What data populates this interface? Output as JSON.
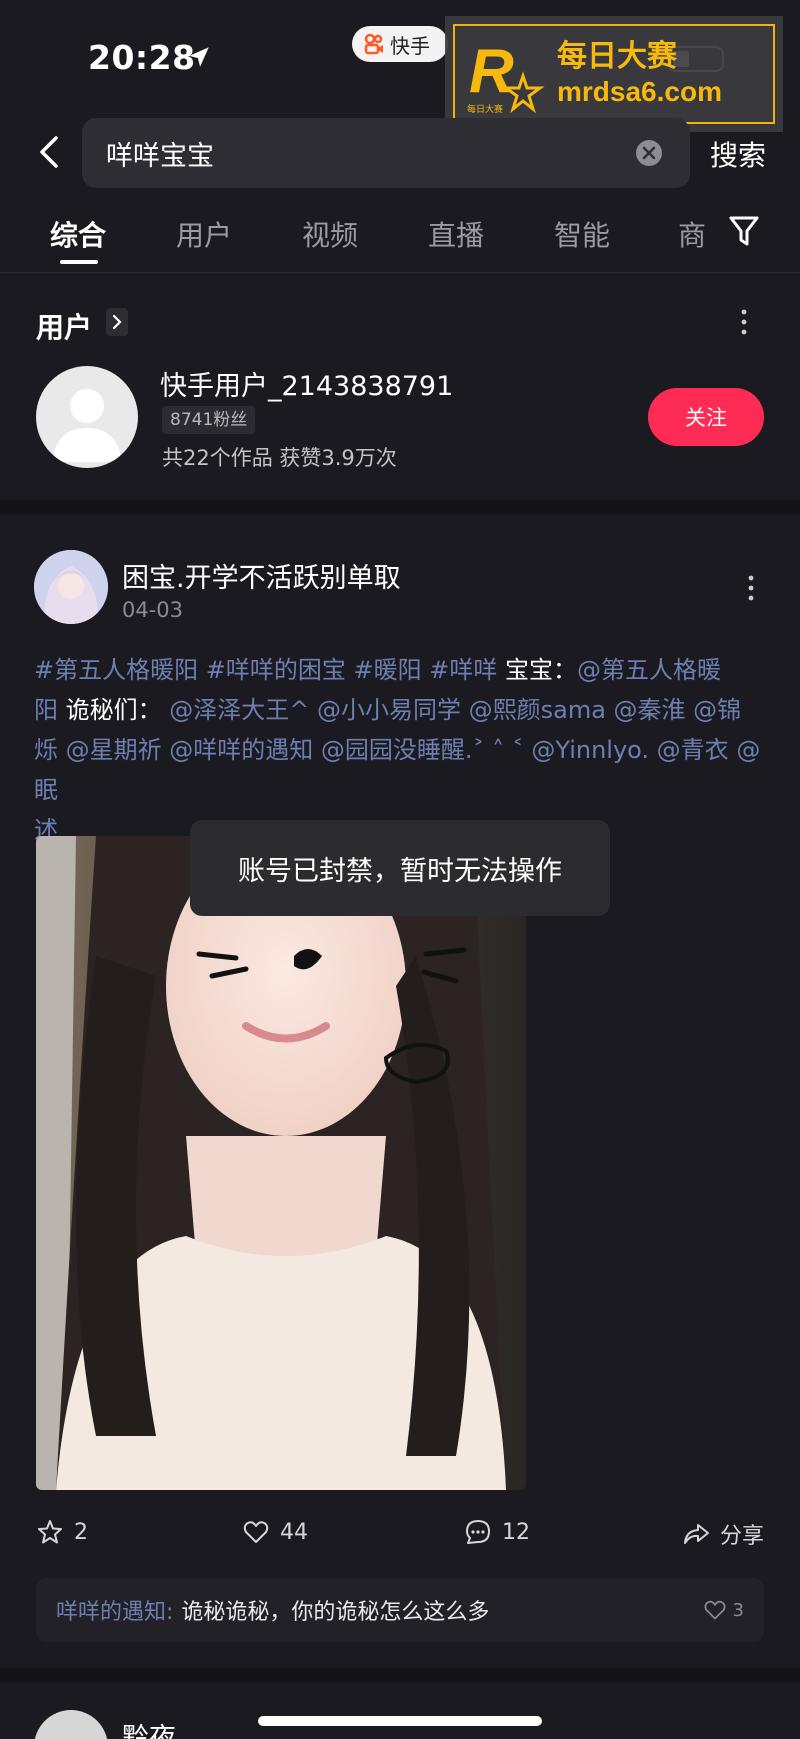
{
  "status_bar": {
    "time": "20:28",
    "app_pill_label": "快手",
    "watermark_title": "每日大赛",
    "watermark_url": "mrdsa6.com",
    "watermark_logo_text": "每日大赛"
  },
  "search": {
    "query": "咩咩宝宝",
    "button_label": "搜索"
  },
  "tabs": [
    {
      "label": "综合",
      "active": true
    },
    {
      "label": "用户",
      "active": false
    },
    {
      "label": "视频",
      "active": false
    },
    {
      "label": "直播",
      "active": false
    },
    {
      "label": "智能",
      "active": false
    },
    {
      "label": "商",
      "active": false
    }
  ],
  "user_section": {
    "title": "用户",
    "user_name": "快手用户_2143838791",
    "fans": "8741粉丝",
    "stats": "共22个作品 获赞3.9万次",
    "follow_label": "关注"
  },
  "post": {
    "author": "困宝.开学不活跃别单取",
    "date": "04-03",
    "tags_line1": "#第五人格暖阳  #咩咩的困宝  #暖阳 #咩咩",
    "text_baobao": "  宝宝：",
    "mention_1": "@第五人格暖",
    "mention_1b": "阳",
    "text_guimi": "  诡秘们：  ",
    "mentions_line2": "@泽泽大王^ @小小易同学 @熙颜sama @秦淮 @锦",
    "mentions_line3": "烁 @星期祈 @咩咩的遇知 @园园没睡醒.˃ ˄ ˂ @Yinnlyo. @青衣 @眠",
    "mentions_line4": "述",
    "toast": "账号已封禁，暂时无法操作",
    "actions": {
      "collect_count": "2",
      "like_count": "44",
      "comment_count": "12",
      "share_label": "分享"
    },
    "comment": {
      "user": "咩咩的遇知:",
      "text": "诡秘诡秘，你的诡秘怎么这么多",
      "likes": "3"
    }
  },
  "next_post": {
    "author": "黔夜"
  },
  "colors": {
    "background": "#1b1a20",
    "follow": "#fe2c55",
    "tag": "#6c7fb0",
    "watermark": "#f7b90d"
  }
}
